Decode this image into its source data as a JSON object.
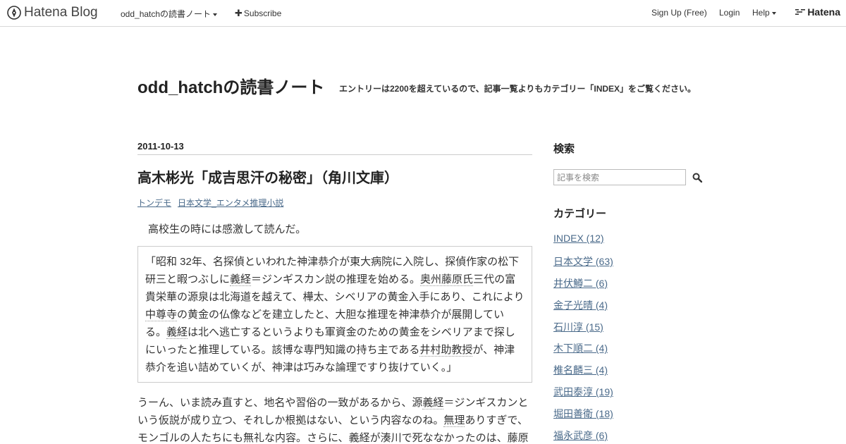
{
  "topbar": {
    "logo_text": "Hatena Blog",
    "blog_menu": "odd_hatchの読書ノート",
    "subscribe": "Subscribe",
    "signup": "Sign Up (Free)",
    "login": "Login",
    "help": "Help",
    "hatena": "Hatena"
  },
  "header": {
    "title": "odd_hatchの読書ノート",
    "description": "エントリーは2200を超えているので、記事一覧よりもカテゴリー「INDEX」をご覧ください。"
  },
  "entry": {
    "date": "2011-10-13",
    "title": "高木彬光「成吉思汗の秘密」（角川文庫）",
    "categories": [
      "トンデモ",
      "日本文学_エンタメ推理小説"
    ],
    "lead": "高校生の時には感激して読んだ。",
    "quote": {
      "p1": "「昭和 32年、名探偵といわれた神津恭介が東大病院に入院し、探偵作家の松下研三と暇つぶしに",
      "kw1": "義経",
      "p2": "＝ジンギスカン説の推理を始める。",
      "kw2": "奥州藤原氏",
      "p3": "三代の富貴栄華の源泉は北海道を越えて、樺太、シベリアの黄金入手にあり、これにより",
      "kw3": "中尊寺",
      "p4": "の黄金の仏像などを建立したと、大胆な推理を神津恭介が展開している。",
      "kw4": "義経",
      "p5": "は北へ逃亡するというよりも軍資金のための黄金をシベリアまで探しにいったと推理している。該博な専門知識の持ち主である",
      "kw5": "井村助教授",
      "p6": "が、神津恭介を追い詰めていくが、神津は巧みな論理ですり抜けていく。」"
    },
    "body": {
      "p1": "うーん、いま読み直すと、地名や習俗の一致があるから、源",
      "kw1": "義経",
      "p2": "＝ジンギスカンという仮説が成り立つ、それしか根拠はない、という内容なのね。",
      "kw2": "無理",
      "p3": "ありすぎで、モンゴルの人たちにも無礼な内容。さらに、",
      "kw3": "義経",
      "p4": "が湊川で死ななかったのは、藤原"
    }
  },
  "sidebar": {
    "search_heading": "検索",
    "search_placeholder": "記事を検索",
    "category_heading": "カテゴリー",
    "categories": [
      "INDEX (12)",
      "日本文学 (63)",
      "井伏鱒二 (6)",
      "金子光晴 (4)",
      "石川淳 (15)",
      "木下順二 (4)",
      "椎名麟三 (4)",
      "武田泰淳 (19)",
      "堀田善衛 (18)",
      "福永武彦 (6)"
    ]
  }
}
